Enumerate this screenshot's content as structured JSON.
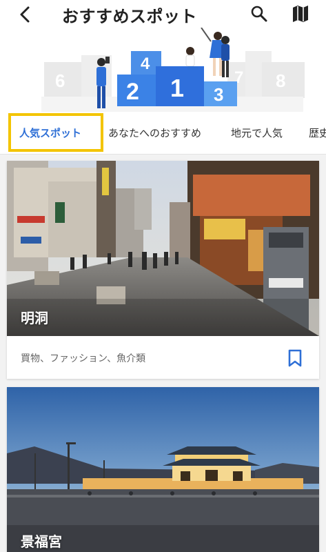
{
  "header": {
    "title": "おすすめスポット",
    "icons": {
      "back": "back-arrow-icon",
      "search": "search-icon",
      "map": "map-icon"
    }
  },
  "ranking_banner": {
    "ranks": [
      "1",
      "2",
      "3",
      "4",
      "6",
      "7",
      "8"
    ]
  },
  "tabs": [
    {
      "label": "人気スポット",
      "active": true
    },
    {
      "label": "あなたへのおすすめ",
      "active": false
    },
    {
      "label": "地元で人気",
      "active": false
    },
    {
      "label": "歴史",
      "active": false
    }
  ],
  "spots": [
    {
      "name": "明洞",
      "tags": "買物、ファッション、魚介類"
    },
    {
      "name": "景福宮"
    }
  ],
  "colors": {
    "accent": "#2e6fd6",
    "highlight": "#f3c400",
    "podium": "#3b82e6"
  }
}
